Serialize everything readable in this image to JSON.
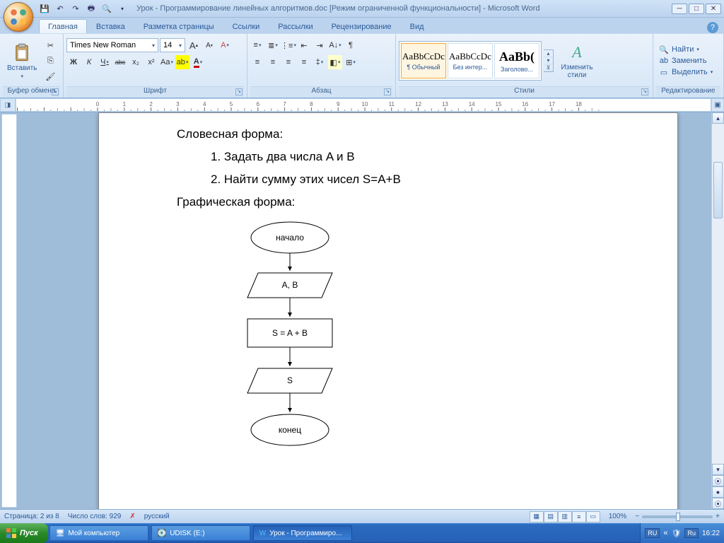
{
  "title": "Урок - Программирование линейных алгоритмов.doc [Режим ограниченной функциональности] - Microsoft Word",
  "tabs": [
    "Главная",
    "Вставка",
    "Разметка страницы",
    "Ссылки",
    "Рассылки",
    "Рецензирование",
    "Вид"
  ],
  "active_tab": 0,
  "ribbon": {
    "clipboard": {
      "paste": "Вставить",
      "label": "Буфер обмена"
    },
    "font": {
      "name": "Times New Roman",
      "size": "14",
      "label": "Шрифт",
      "bold": "Ж",
      "italic": "К",
      "underline": "Ч",
      "strike": "abc",
      "sub": "x₂",
      "sup": "x²",
      "case": "Aa",
      "grow": "A",
      "shrink": "A",
      "clear": "A"
    },
    "para": {
      "label": "Абзац"
    },
    "styles": {
      "label": "Стили",
      "items": [
        {
          "preview": "AaBbCcDc",
          "name": "¶ Обычный"
        },
        {
          "preview": "AaBbCcDc",
          "name": "Без интер..."
        },
        {
          "preview": "AaBb(",
          "name": "Заголово..."
        }
      ],
      "change": "Изменить стили"
    },
    "editing": {
      "label": "Редактирование",
      "find": "Найти",
      "replace": "Заменить",
      "select": "Выделить"
    }
  },
  "document": {
    "h1": "Словесная форма:",
    "li1": "1. Задать два числа A и B",
    "li2": "2. Найти сумму этих чисел S=A+B",
    "h2": "Графическая форма:",
    "flow": {
      "start": "начало",
      "input": "A, B",
      "proc": "S = A + B",
      "output": "S",
      "end": "конец"
    }
  },
  "status": {
    "page": "Страница: 2 из 8",
    "words": "Число слов: 929",
    "lang": "русский",
    "zoom": "100%"
  },
  "taskbar": {
    "start": "Пуск",
    "items": [
      "Мой компьютер",
      "UDISK (E:)",
      "Урок - Программиро..."
    ],
    "lang1": "RU",
    "lang2": "Ru",
    "clock": "16:22"
  }
}
